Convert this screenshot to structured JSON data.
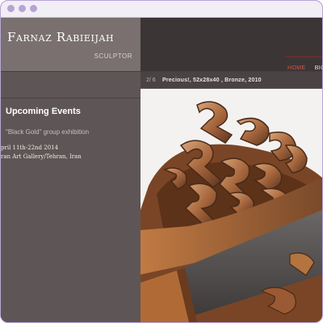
{
  "site": {
    "name": "Farnaz Rabieijah",
    "subtitle": "SCULPTOR"
  },
  "nav": {
    "items": [
      {
        "label": "HOME",
        "active": true
      },
      {
        "label": "BIOGI",
        "active": false
      }
    ]
  },
  "sidebar": {
    "heading": "Upcoming Events",
    "event": {
      "name": "\"Black Gold\" group exhibition",
      "date": "pril 11th-22nd 2014",
      "venue": "ran Art Gallery/Tehran, Iran"
    }
  },
  "gallery": {
    "counter": "2/ 6",
    "caption": "Precious!, 52x28x40 , Bronze, 2010"
  },
  "colors": {
    "nav_accent": "#e0523e",
    "header_left": "#79706f",
    "header_right": "#3c3536",
    "sidebar_bg": "#5e5656"
  }
}
